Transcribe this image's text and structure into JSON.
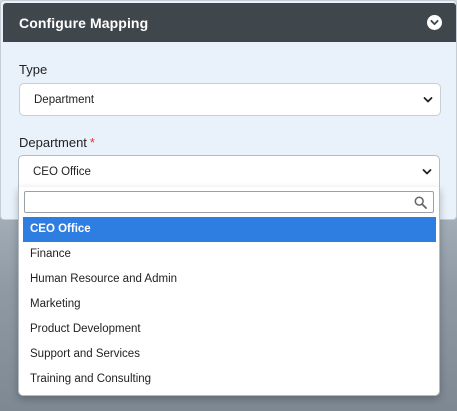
{
  "panel": {
    "title": "Configure Mapping",
    "collapse_icon": "chevron-down-circle-icon"
  },
  "type_field": {
    "label": "Type",
    "value": "Department"
  },
  "department_field": {
    "label": "Department",
    "required_mark": "*",
    "value": "CEO Office"
  },
  "dropdown": {
    "search_value": "",
    "search_icon": "search-icon",
    "options": [
      {
        "label": "CEO Office",
        "selected": true
      },
      {
        "label": "Finance"
      },
      {
        "label": "Human Resource and Admin"
      },
      {
        "label": "Marketing"
      },
      {
        "label": "Product Development"
      },
      {
        "label": "Support and Services"
      },
      {
        "label": "Training and Consulting"
      }
    ]
  },
  "colors": {
    "header_bg": "#3f464c",
    "panel_bg": "#e9f1fb",
    "selected_option_bg": "#2e7de1",
    "required_mark": "#d03b3b"
  }
}
